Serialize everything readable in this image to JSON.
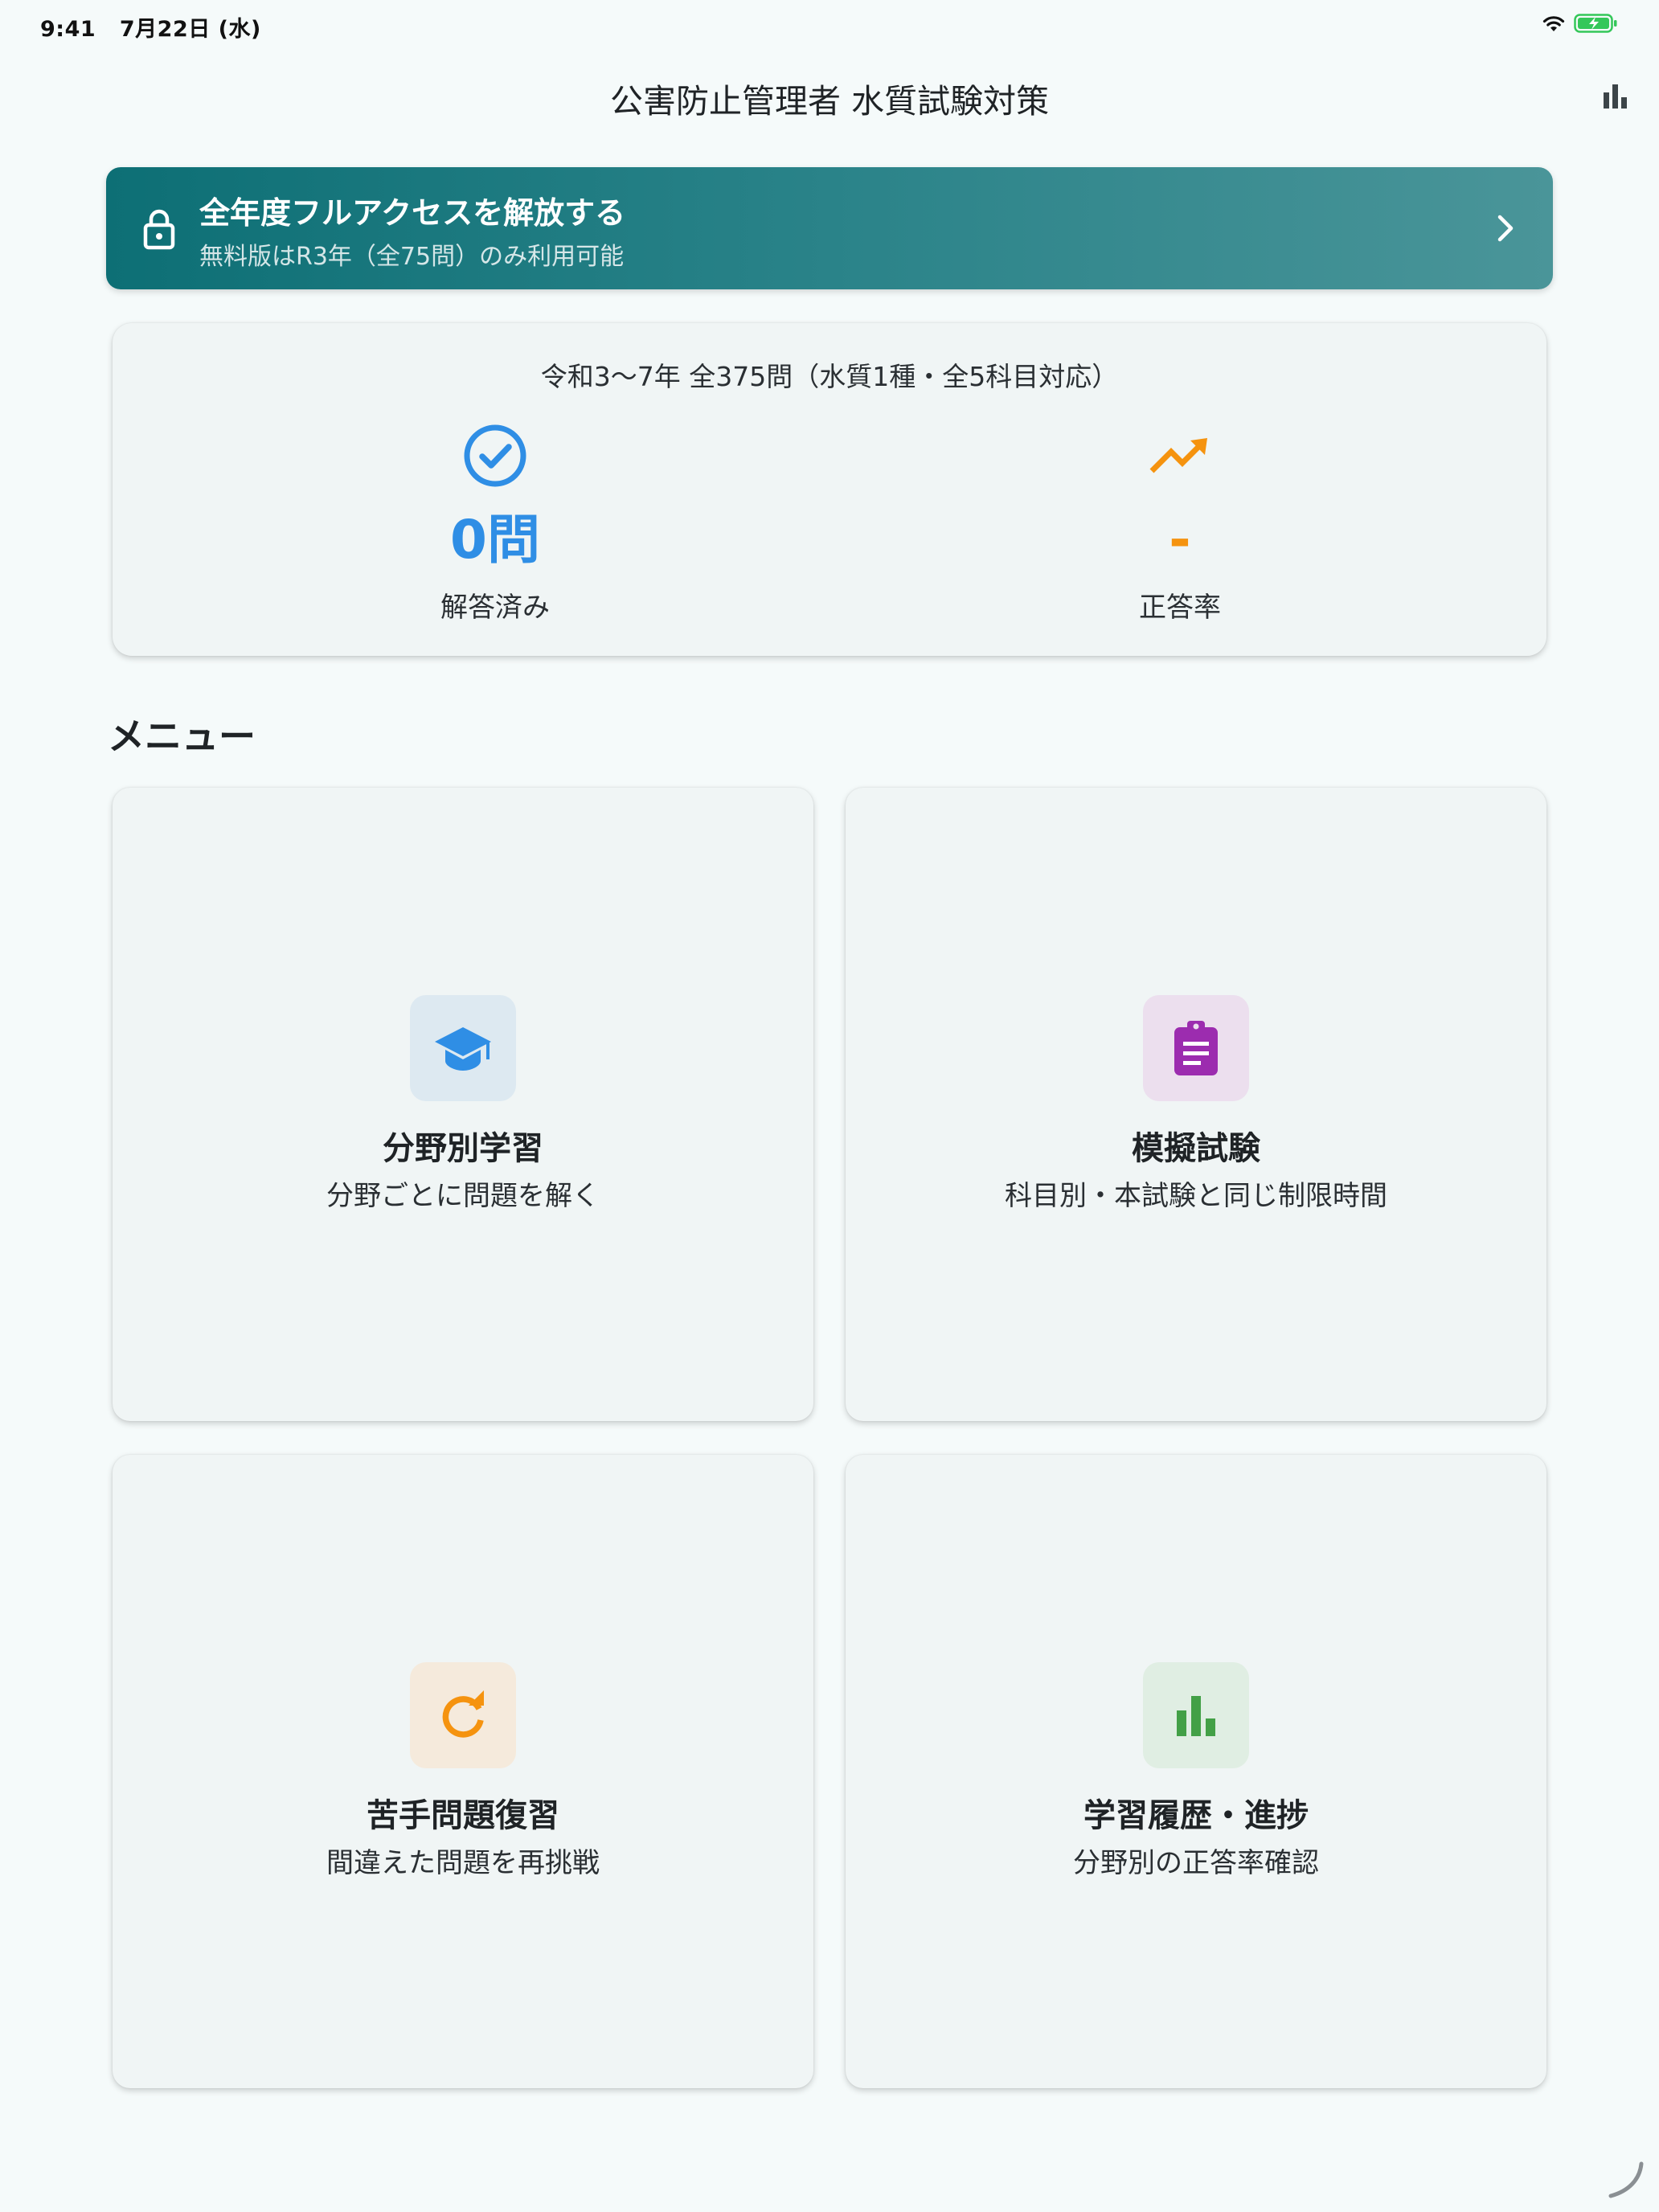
{
  "status_bar": {
    "time": "9:41",
    "date": "7月22日 (水)"
  },
  "app_bar": {
    "title": "公害防止管理者 水質試験対策",
    "action_icon": "bar-chart-icon"
  },
  "unlock_banner": {
    "title": "全年度フルアクセスを解放する",
    "subtitle": "無料版はR3年（全75問）のみ利用可能",
    "icon": "lock-icon"
  },
  "stats": {
    "heading": "令和3〜7年 全375問（水質1種・全5科目対応）",
    "answered": {
      "value": "0問",
      "label": "解答済み",
      "icon": "check-circle-icon",
      "color": "#2f8ee5"
    },
    "accuracy": {
      "value": "-",
      "label": "正答率",
      "icon": "trending-up-icon",
      "color": "#f5930f"
    }
  },
  "menu": {
    "heading": "メニュー",
    "items": [
      {
        "title": "分野別学習",
        "subtitle": "分野ごとに問題を解く",
        "icon": "graduation-cap-icon",
        "color": "#2f8ee5",
        "bg": "#dde9f1"
      },
      {
        "title": "模擬試験",
        "subtitle": "科目別・本試験と同じ制限時間",
        "icon": "clipboard-icon",
        "color": "#9c2caf",
        "bg": "#ecdfee"
      },
      {
        "title": "苦手問題復習",
        "subtitle": "間違えた問題を再挑戦",
        "icon": "refresh-icon",
        "color": "#f5930f",
        "bg": "#f5eadc"
      },
      {
        "title": "学習履歴・進捗",
        "subtitle": "分野別の正答率確認",
        "icon": "bar-chart-icon",
        "color": "#43a047",
        "bg": "#e0eee3"
      }
    ]
  }
}
